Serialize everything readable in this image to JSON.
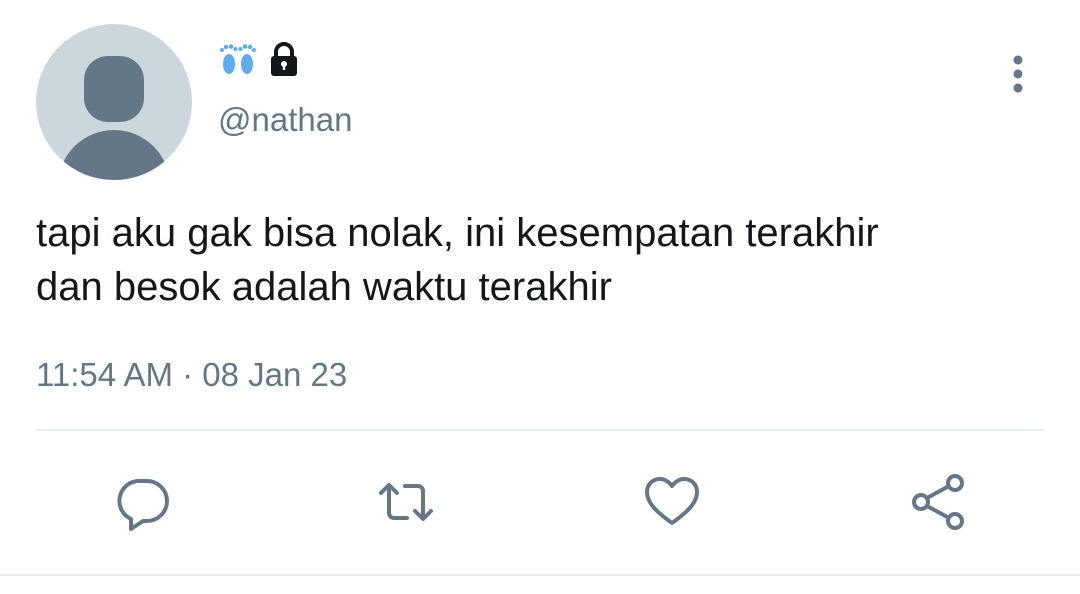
{
  "tweet": {
    "display_name_icons": [
      "footprints-icon",
      "lock-icon"
    ],
    "handle": "@nathan",
    "text": "tapi aku gak bisa nolak, ini kesempatan terakhir\ndan besok adalah waktu terakhir",
    "timestamp": "11:54 AM · 08 Jan 23"
  },
  "actions": [
    "reply-icon",
    "retweet-icon",
    "like-icon",
    "share-icon"
  ],
  "colors": {
    "text": "#14171a",
    "secondary": "#657786",
    "avatar_bg": "#ccd6dd",
    "divider": "#e6ecf0",
    "footprints": "#5dadec"
  }
}
